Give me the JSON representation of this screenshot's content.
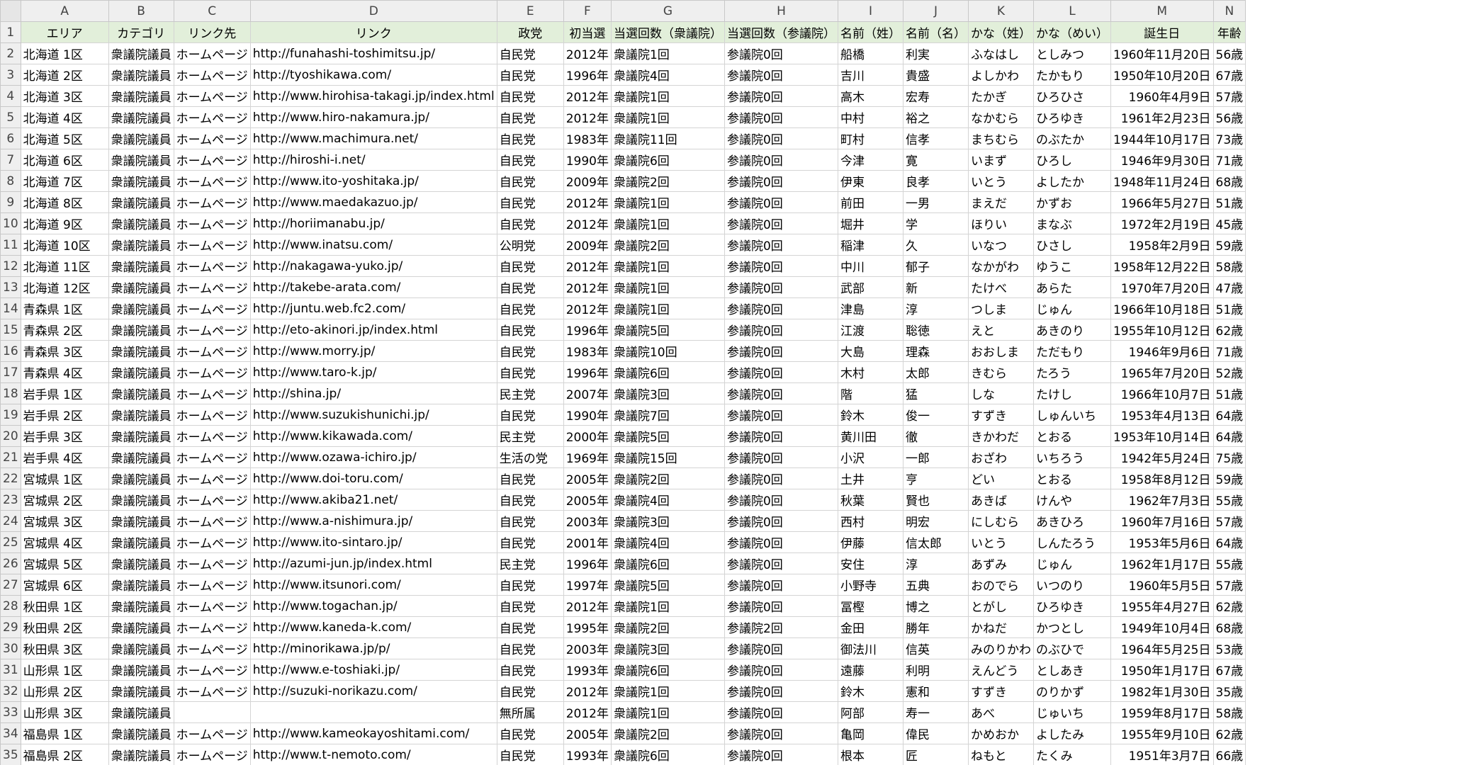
{
  "columns": [
    "A",
    "B",
    "C",
    "D",
    "E",
    "F",
    "G",
    "H",
    "I",
    "J",
    "K",
    "L",
    "M",
    "N"
  ],
  "header": [
    "エリア",
    "カテゴリ",
    "リンク先",
    "リンク",
    "政党",
    "初当選",
    "当選回数（衆議院）",
    "当選回数（参議院）",
    "名前（姓）",
    "名前（名）",
    "かな（姓）",
    "かな（めい）",
    "誕生日",
    "年齢"
  ],
  "rows": [
    {
      "n": "2",
      "c": [
        "北海道 1区",
        "衆議院議員",
        "ホームページ",
        "http://funahashi-toshimitsu.jp/",
        "自民党",
        "2012年",
        "衆議院1回",
        "参議院0回",
        "船橋",
        "利実",
        "ふなはし",
        "としみつ",
        "1960年11月20日",
        "56歳"
      ]
    },
    {
      "n": "3",
      "c": [
        "北海道 2区",
        "衆議院議員",
        "ホームページ",
        "http://tyoshikawa.com/",
        "自民党",
        "1996年",
        "衆議院4回",
        "参議院0回",
        "吉川",
        "貴盛",
        "よしかわ",
        "たかもり",
        "1950年10月20日",
        "67歳"
      ]
    },
    {
      "n": "4",
      "c": [
        "北海道 3区",
        "衆議院議員",
        "ホームページ",
        "http://www.hirohisa-takagi.jp/index.html",
        "自民党",
        "2012年",
        "衆議院1回",
        "参議院0回",
        "高木",
        "宏寿",
        "たかぎ",
        "ひろひさ",
        "1960年4月9日",
        "57歳"
      ]
    },
    {
      "n": "5",
      "c": [
        "北海道 4区",
        "衆議院議員",
        "ホームページ",
        "http://www.hiro-nakamura.jp/",
        "自民党",
        "2012年",
        "衆議院1回",
        "参議院0回",
        "中村",
        "裕之",
        "なかむら",
        "ひろゆき",
        "1961年2月23日",
        "56歳"
      ]
    },
    {
      "n": "6",
      "c": [
        "北海道 5区",
        "衆議院議員",
        "ホームページ",
        "http://www.machimura.net/",
        "自民党",
        "1983年",
        "衆議院11回",
        "参議院0回",
        "町村",
        "信孝",
        "まちむら",
        "のぶたか",
        "1944年10月17日",
        "73歳"
      ]
    },
    {
      "n": "7",
      "c": [
        "北海道 6区",
        "衆議院議員",
        "ホームページ",
        "http://hiroshi-i.net/",
        "自民党",
        "1990年",
        "衆議院6回",
        "参議院0回",
        "今津",
        "寛",
        "いまず",
        "ひろし",
        "1946年9月30日",
        "71歳"
      ]
    },
    {
      "n": "8",
      "c": [
        "北海道 7区",
        "衆議院議員",
        "ホームページ",
        "http://www.ito-yoshitaka.jp/",
        "自民党",
        "2009年",
        "衆議院2回",
        "参議院0回",
        "伊東",
        "良孝",
        "いとう",
        "よしたか",
        "1948年11月24日",
        "68歳"
      ]
    },
    {
      "n": "9",
      "c": [
        "北海道 8区",
        "衆議院議員",
        "ホームページ",
        "http://www.maedakazuo.jp/",
        "自民党",
        "2012年",
        "衆議院1回",
        "参議院0回",
        "前田",
        "一男",
        "まえだ",
        "かずお",
        "1966年5月27日",
        "51歳"
      ]
    },
    {
      "n": "10",
      "c": [
        "北海道 9区",
        "衆議院議員",
        "ホームページ",
        "http://horiimanabu.jp/",
        "自民党",
        "2012年",
        "衆議院1回",
        "参議院0回",
        "堀井",
        "学",
        "ほりい",
        "まなぶ",
        "1972年2月19日",
        "45歳"
      ]
    },
    {
      "n": "11",
      "c": [
        "北海道 10区",
        "衆議院議員",
        "ホームページ",
        "http://www.inatsu.com/",
        "公明党",
        "2009年",
        "衆議院2回",
        "参議院0回",
        "稲津",
        "久",
        "いなつ",
        "ひさし",
        "1958年2月9日",
        "59歳"
      ]
    },
    {
      "n": "12",
      "c": [
        "北海道 11区",
        "衆議院議員",
        "ホームページ",
        "http://nakagawa-yuko.jp/",
        "自民党",
        "2012年",
        "衆議院1回",
        "参議院0回",
        "中川",
        "郁子",
        "なかがわ",
        "ゆうこ",
        "1958年12月22日",
        "58歳"
      ]
    },
    {
      "n": "13",
      "c": [
        "北海道 12区",
        "衆議院議員",
        "ホームページ",
        "http://takebe-arata.com/",
        "自民党",
        "2012年",
        "衆議院1回",
        "参議院0回",
        "武部",
        "新",
        "たけべ",
        "あらた",
        "1970年7月20日",
        "47歳"
      ]
    },
    {
      "n": "14",
      "c": [
        "青森県 1区",
        "衆議院議員",
        "ホームページ",
        "http://juntu.web.fc2.com/",
        "自民党",
        "2012年",
        "衆議院1回",
        "参議院0回",
        "津島",
        "淳",
        "つしま",
        "じゅん",
        "1966年10月18日",
        "51歳"
      ]
    },
    {
      "n": "15",
      "c": [
        "青森県 2区",
        "衆議院議員",
        "ホームページ",
        "http://eto-akinori.jp/index.html",
        "自民党",
        "1996年",
        "衆議院5回",
        "参議院0回",
        "江渡",
        "聡徳",
        "えと",
        "あきのり",
        "1955年10月12日",
        "62歳"
      ]
    },
    {
      "n": "16",
      "c": [
        "青森県 3区",
        "衆議院議員",
        "ホームページ",
        "http://www.morry.jp/",
        "自民党",
        "1983年",
        "衆議院10回",
        "参議院0回",
        "大島",
        "理森",
        "おおしま",
        "ただもり",
        "1946年9月6日",
        "71歳"
      ]
    },
    {
      "n": "17",
      "c": [
        "青森県 4区",
        "衆議院議員",
        "ホームページ",
        "http://www.taro-k.jp/",
        "自民党",
        "1996年",
        "衆議院6回",
        "参議院0回",
        "木村",
        "太郎",
        "きむら",
        "たろう",
        "1965年7月20日",
        "52歳"
      ]
    },
    {
      "n": "18",
      "c": [
        "岩手県 1区",
        "衆議院議員",
        "ホームページ",
        "http://shina.jp/",
        "民主党",
        "2007年",
        "衆議院3回",
        "参議院0回",
        "階",
        "猛",
        "しな",
        "たけし",
        "1966年10月7日",
        "51歳"
      ]
    },
    {
      "n": "19",
      "c": [
        "岩手県 2区",
        "衆議院議員",
        "ホームページ",
        "http://www.suzukishunichi.jp/",
        "自民党",
        "1990年",
        "衆議院7回",
        "参議院0回",
        "鈴木",
        "俊一",
        "すずき",
        "しゅんいち",
        "1953年4月13日",
        "64歳"
      ]
    },
    {
      "n": "20",
      "c": [
        "岩手県 3区",
        "衆議院議員",
        "ホームページ",
        "http://www.kikawada.com/",
        "民主党",
        "2000年",
        "衆議院5回",
        "参議院0回",
        "黄川田",
        "徹",
        "きかわだ",
        "とおる",
        "1953年10月14日",
        "64歳"
      ]
    },
    {
      "n": "21",
      "c": [
        "岩手県 4区",
        "衆議院議員",
        "ホームページ",
        "http://www.ozawa-ichiro.jp/",
        "生活の党",
        "1969年",
        "衆議院15回",
        "参議院0回",
        "小沢",
        "一郎",
        "おざわ",
        "いちろう",
        "1942年5月24日",
        "75歳"
      ]
    },
    {
      "n": "22",
      "c": [
        "宮城県 1区",
        "衆議院議員",
        "ホームページ",
        "http://www.doi-toru.com/",
        "自民党",
        "2005年",
        "衆議院2回",
        "参議院0回",
        "土井",
        "亨",
        "どい",
        "とおる",
        "1958年8月12日",
        "59歳"
      ]
    },
    {
      "n": "23",
      "c": [
        "宮城県 2区",
        "衆議院議員",
        "ホームページ",
        "http://www.akiba21.net/",
        "自民党",
        "2005年",
        "衆議院4回",
        "参議院0回",
        "秋葉",
        "賢也",
        "あきば",
        "けんや",
        "1962年7月3日",
        "55歳"
      ]
    },
    {
      "n": "24",
      "c": [
        "宮城県 3区",
        "衆議院議員",
        "ホームページ",
        "http://www.a-nishimura.jp/",
        "自民党",
        "2003年",
        "衆議院3回",
        "参議院0回",
        "西村",
        "明宏",
        "にしむら",
        "あきひろ",
        "1960年7月16日",
        "57歳"
      ]
    },
    {
      "n": "25",
      "c": [
        "宮城県 4区",
        "衆議院議員",
        "ホームページ",
        "http://www.ito-sintaro.jp/",
        "自民党",
        "2001年",
        "衆議院4回",
        "参議院0回",
        "伊藤",
        "信太郎",
        "いとう",
        "しんたろう",
        "1953年5月6日",
        "64歳"
      ]
    },
    {
      "n": "26",
      "c": [
        "宮城県 5区",
        "衆議院議員",
        "ホームページ",
        "http://azumi-jun.jp/index.html",
        "民主党",
        "1996年",
        "衆議院6回",
        "参議院0回",
        "安住",
        "淳",
        "あずみ",
        "じゅん",
        "1962年1月17日",
        "55歳"
      ]
    },
    {
      "n": "27",
      "c": [
        "宮城県 6区",
        "衆議院議員",
        "ホームページ",
        "http://www.itsunori.com/",
        "自民党",
        "1997年",
        "衆議院5回",
        "参議院0回",
        "小野寺",
        "五典",
        "おのでら",
        "いつのり",
        "1960年5月5日",
        "57歳"
      ]
    },
    {
      "n": "28",
      "c": [
        "秋田県 1区",
        "衆議院議員",
        "ホームページ",
        "http://www.togachan.jp/",
        "自民党",
        "2012年",
        "衆議院1回",
        "参議院0回",
        "冨樫",
        "博之",
        "とがし",
        "ひろゆき",
        "1955年4月27日",
        "62歳"
      ]
    },
    {
      "n": "29",
      "c": [
        "秋田県 2区",
        "衆議院議員",
        "ホームページ",
        "http://www.kaneda-k.com/",
        "自民党",
        "1995年",
        "衆議院2回",
        "参議院2回",
        "金田",
        "勝年",
        "かねだ",
        "かつとし",
        "1949年10月4日",
        "68歳"
      ]
    },
    {
      "n": "30",
      "c": [
        "秋田県 3区",
        "衆議院議員",
        "ホームページ",
        "http://minorikawa.jp/p/",
        "自民党",
        "2003年",
        "衆議院3回",
        "参議院0回",
        "御法川",
        "信英",
        "みのりかわ",
        "のぶひで",
        "1964年5月25日",
        "53歳"
      ]
    },
    {
      "n": "31",
      "c": [
        "山形県 1区",
        "衆議院議員",
        "ホームページ",
        "http://www.e-toshiaki.jp/",
        "自民党",
        "1993年",
        "衆議院6回",
        "参議院0回",
        "遠藤",
        "利明",
        "えんどう",
        "としあき",
        "1950年1月17日",
        "67歳"
      ]
    },
    {
      "n": "32",
      "c": [
        "山形県 2区",
        "衆議院議員",
        "ホームページ",
        "http://suzuki-norikazu.com/",
        "自民党",
        "2012年",
        "衆議院1回",
        "参議院0回",
        "鈴木",
        "憲和",
        "すずき",
        "のりかず",
        "1982年1月30日",
        "35歳"
      ]
    },
    {
      "n": "33",
      "c": [
        "山形県 3区",
        "衆議院議員",
        "",
        "",
        "無所属",
        "2012年",
        "衆議院1回",
        "参議院0回",
        "阿部",
        "寿一",
        "あべ",
        "じゅいち",
        "1959年8月17日",
        "58歳"
      ]
    },
    {
      "n": "34",
      "c": [
        "福島県 1区",
        "衆議院議員",
        "ホームページ",
        "http://www.kameokayoshitami.com/",
        "自民党",
        "2005年",
        "衆議院2回",
        "参議院0回",
        "亀岡",
        "偉民",
        "かめおか",
        "よしたみ",
        "1955年9月10日",
        "62歳"
      ]
    },
    {
      "n": "35",
      "c": [
        "福島県 2区",
        "衆議院議員",
        "ホームページ",
        "http://www.t-nemoto.com/",
        "自民党",
        "1993年",
        "衆議院6回",
        "参議院0回",
        "根本",
        "匠",
        "ねもと",
        "たくみ",
        "1951年3月7日",
        "66歳"
      ]
    }
  ]
}
